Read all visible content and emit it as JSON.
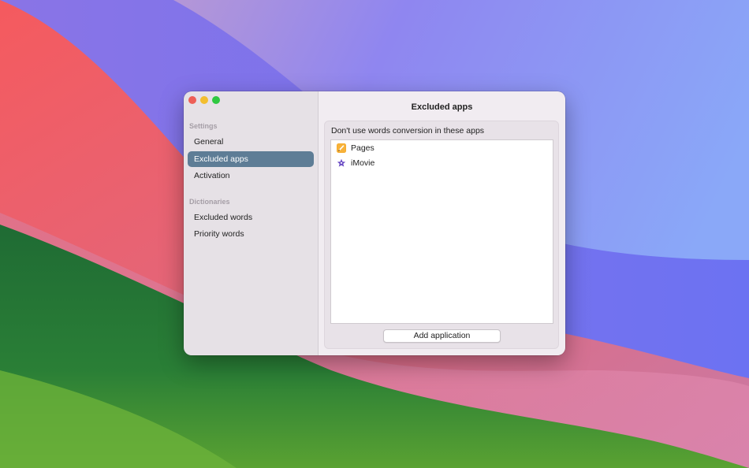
{
  "window": {
    "title": "Excluded apps"
  },
  "sidebar": {
    "sections": [
      {
        "header": "Settings",
        "items": [
          {
            "label": "General",
            "selected": false
          },
          {
            "label": "Excluded apps",
            "selected": true
          },
          {
            "label": "Activation",
            "selected": false
          }
        ]
      },
      {
        "header": "Dictionaries",
        "items": [
          {
            "label": "Excluded words",
            "selected": false
          },
          {
            "label": "Priority words",
            "selected": false
          }
        ]
      }
    ]
  },
  "main": {
    "group_label": "Don't use words conversion in these apps",
    "apps": [
      {
        "name": "Pages",
        "icon": "pages-icon",
        "color": "#f5a623"
      },
      {
        "name": "iMovie",
        "icon": "imovie-star-icon",
        "color": "#6a4bc4"
      }
    ],
    "add_button_label": "Add application"
  },
  "colors": {
    "sidebar_selected": "#5e7d96",
    "close": "#ee5f57",
    "minimize": "#f3be2f",
    "zoom": "#2fc841"
  }
}
